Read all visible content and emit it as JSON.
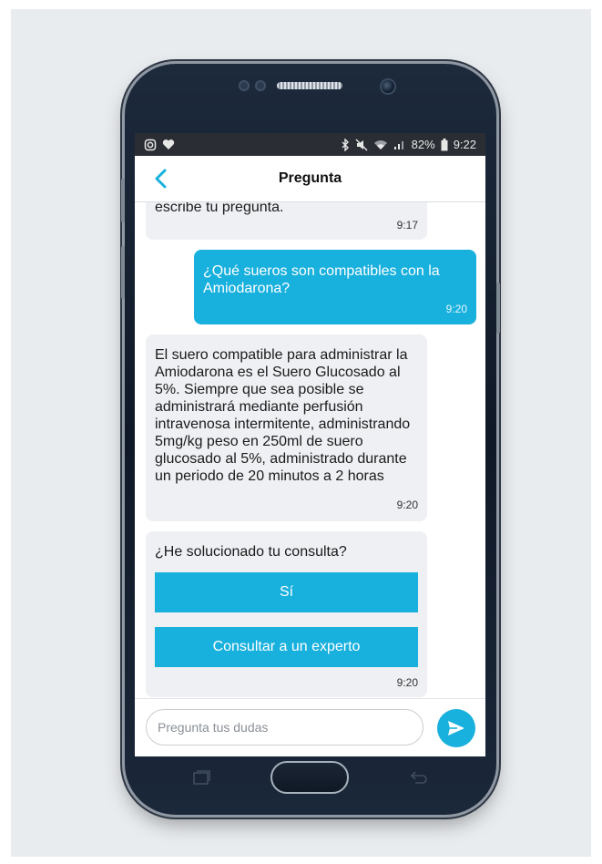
{
  "status_bar": {
    "left_icons": [
      "instagram-icon",
      "heart-icon"
    ],
    "right_icons": [
      "bluetooth-icon",
      "mute-icon",
      "wifi-icon",
      "signal-icon",
      "battery-icon"
    ],
    "battery": "82%",
    "time": "9:22"
  },
  "app_bar": {
    "title": "Pregunta",
    "back_icon": "chevron-left-icon"
  },
  "messages": [
    {
      "sender": "bot",
      "text": "escribe tu pregunta.",
      "time": "9:17"
    },
    {
      "sender": "user",
      "text": "¿Qué sueros son compatibles con la Amiodarona?",
      "time": "9:20"
    },
    {
      "sender": "bot",
      "text": "El suero compatible para administrar la Amiodarona es el Suero Glucosado al 5%. Siempre que sea posible se administrará mediante perfusión intravenosa intermitente, administrando 5mg/kg peso en 250ml de suero glucosado al 5%, administrado durante un periodo de 20 minutos a 2 horas",
      "time": "9:20"
    },
    {
      "sender": "bot",
      "text": "¿He solucionado tu consulta?",
      "time": "9:20",
      "buttons": [
        "Sí",
        "Consultar a un experto"
      ]
    }
  ],
  "composer": {
    "placeholder": "Pregunta tus dudas",
    "send_icon": "send-icon"
  },
  "colors": {
    "accent": "#18b0dd",
    "bot_bubble": "#eef0f3",
    "status_bar": "#2a2d33",
    "phone_body": "#142033"
  }
}
